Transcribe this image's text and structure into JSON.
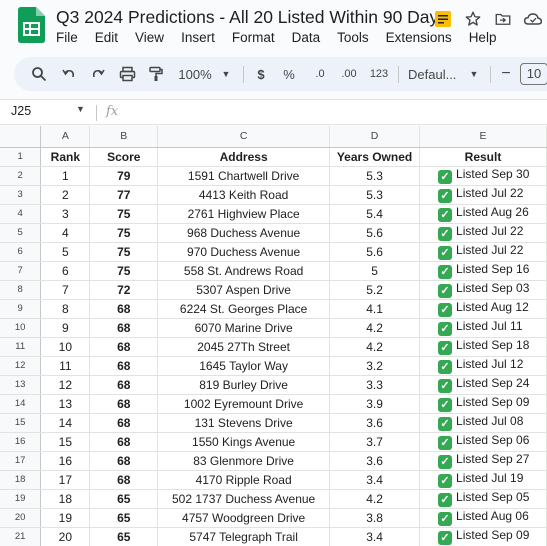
{
  "doc": {
    "title": "Q3 2024 Predictions - All 20 Listed Within 90 Days"
  },
  "menu": [
    "File",
    "Edit",
    "View",
    "Insert",
    "Format",
    "Data",
    "Tools",
    "Extensions",
    "Help"
  ],
  "toolbar": {
    "zoom": "100%",
    "currency": "$",
    "percent": "%",
    "dec_decrease": ".0",
    "dec_increase": ".00",
    "number_format": "123",
    "font": "Defaul...",
    "font_size": "10"
  },
  "formula_bar": {
    "name_box": "J25",
    "fx": "fx",
    "formula": ""
  },
  "columns": [
    "A",
    "B",
    "C",
    "D",
    "E"
  ],
  "header_row": {
    "row_num": "1",
    "rank": "Rank",
    "score": "Score",
    "address": "Address",
    "years": "Years Owned",
    "result": "Result"
  },
  "rows": [
    {
      "row_num": "2",
      "rank": "1",
      "score": "79",
      "address": "1591 Chartwell Drive",
      "years": "5.3",
      "result": "Listed Sep 30"
    },
    {
      "row_num": "3",
      "rank": "2",
      "score": "77",
      "address": "4413 Keith Road",
      "years": "5.3",
      "result": "Listed Jul 22"
    },
    {
      "row_num": "4",
      "rank": "3",
      "score": "75",
      "address": "2761 Highview Place",
      "years": "5.4",
      "result": "Listed Aug 26"
    },
    {
      "row_num": "5",
      "rank": "4",
      "score": "75",
      "address": "968 Duchess Avenue",
      "years": "5.6",
      "result": "Listed Jul 22"
    },
    {
      "row_num": "6",
      "rank": "5",
      "score": "75",
      "address": "970 Duchess Avenue",
      "years": "5.6",
      "result": "Listed Jul 22"
    },
    {
      "row_num": "7",
      "rank": "6",
      "score": "75",
      "address": "558 St. Andrews Road",
      "years": "5",
      "result": "Listed Sep 16"
    },
    {
      "row_num": "8",
      "rank": "7",
      "score": "72",
      "address": "5307 Aspen Drive",
      "years": "5.2",
      "result": "Listed Sep 03"
    },
    {
      "row_num": "9",
      "rank": "8",
      "score": "68",
      "address": "6224 St. Georges Place",
      "years": "4.1",
      "result": "Listed Aug 12"
    },
    {
      "row_num": "10",
      "rank": "9",
      "score": "68",
      "address": "6070 Marine Drive",
      "years": "4.2",
      "result": "Listed Jul 11"
    },
    {
      "row_num": "11",
      "rank": "10",
      "score": "68",
      "address": "2045 27Th Street",
      "years": "4.2",
      "result": "Listed Sep 18"
    },
    {
      "row_num": "12",
      "rank": "11",
      "score": "68",
      "address": "1645 Taylor Way",
      "years": "3.2",
      "result": "Listed Jul 12"
    },
    {
      "row_num": "13",
      "rank": "12",
      "score": "68",
      "address": "819 Burley Drive",
      "years": "3.3",
      "result": "Listed Sep 24"
    },
    {
      "row_num": "14",
      "rank": "13",
      "score": "68",
      "address": "1002 Eyremount Drive",
      "years": "3.9",
      "result": "Listed Sep 09"
    },
    {
      "row_num": "15",
      "rank": "14",
      "score": "68",
      "address": "131 Stevens Drive",
      "years": "3.6",
      "result": "Listed Jul 08"
    },
    {
      "row_num": "16",
      "rank": "15",
      "score": "68",
      "address": "1550 Kings Avenue",
      "years": "3.7",
      "result": "Listed Sep 06"
    },
    {
      "row_num": "17",
      "rank": "16",
      "score": "68",
      "address": "83 Glenmore Drive",
      "years": "3.6",
      "result": "Listed Sep 27"
    },
    {
      "row_num": "18",
      "rank": "17",
      "score": "68",
      "address": "4170 Ripple Road",
      "years": "3.4",
      "result": "Listed Jul 19"
    },
    {
      "row_num": "19",
      "rank": "18",
      "score": "65",
      "address": "502 1737 Duchess Avenue",
      "years": "4.2",
      "result": "Listed Sep 05"
    },
    {
      "row_num": "20",
      "rank": "19",
      "score": "65",
      "address": "4757 Woodgreen Drive",
      "years": "3.8",
      "result": "Listed Aug 06"
    },
    {
      "row_num": "21",
      "rank": "20",
      "score": "65",
      "address": "5747 Telegraph Trail",
      "years": "3.4",
      "result": "Listed Sep 09"
    }
  ],
  "colors": {
    "accent": "#34a853",
    "toolbar_bg": "#edf2fa",
    "header_bg": "#f8f9fa"
  }
}
